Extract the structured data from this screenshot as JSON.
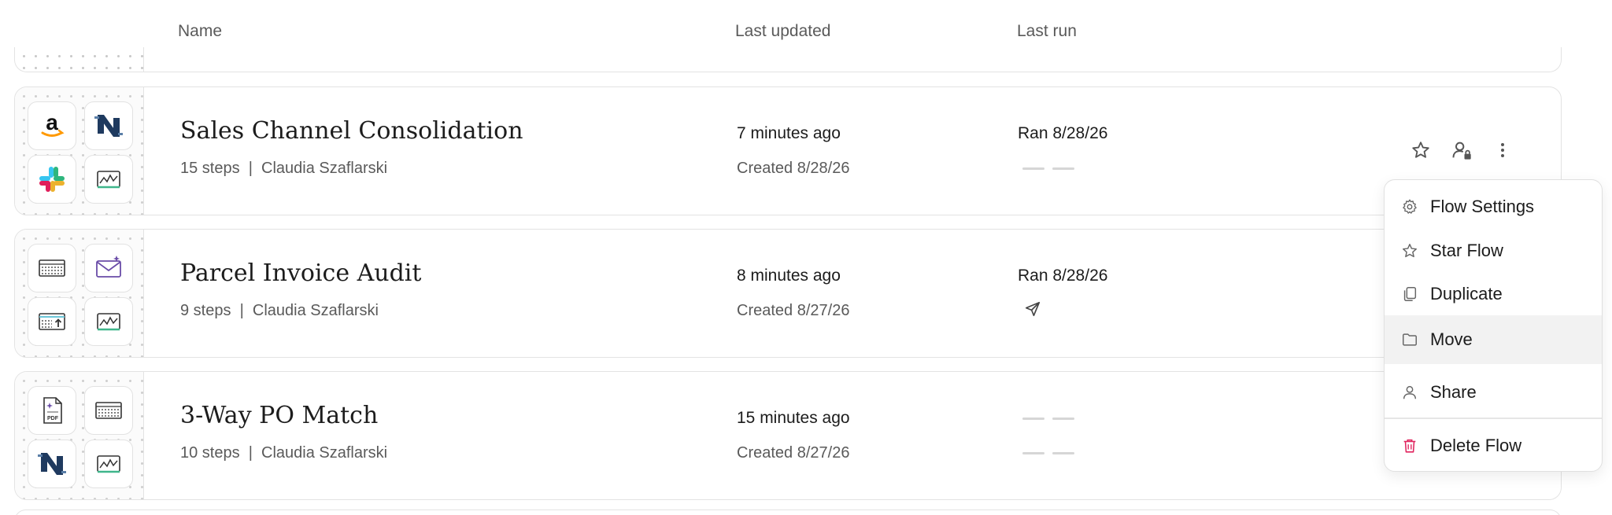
{
  "header": {
    "name": "Name",
    "last_updated": "Last updated",
    "last_run": "Last run"
  },
  "flows": [
    {
      "title": "Sales Channel Consolidation",
      "meta": "15 steps  |  Claudia Szaflarski",
      "updated": "7 minutes ago",
      "created": "Created 8/28/26",
      "last_run": "Ran 8/28/26",
      "icons": [
        "amazon-icon",
        "netsuite-icon",
        "slack-icon",
        "chart-icon"
      ]
    },
    {
      "title": "Parcel Invoice Audit",
      "meta": "9 steps  |  Claudia Szaflarski",
      "updated": "8 minutes ago",
      "created": "Created 8/27/26",
      "last_run": "Ran 8/28/26",
      "icons": [
        "table-icon",
        "email-icon",
        "upload-table-icon",
        "chart-icon"
      ]
    },
    {
      "title": "3-Way PO Match",
      "meta": "10 steps  |  Claudia Szaflarski",
      "updated": "15 minutes ago",
      "created": "Created 8/27/26",
      "last_run": "",
      "icons": [
        "pdf-icon",
        "table-icon",
        "netsuite-icon",
        "chart-icon"
      ]
    }
  ],
  "menu": {
    "items": [
      {
        "label": "Flow Settings",
        "icon": "gear-icon"
      },
      {
        "label": "Star Flow",
        "icon": "star-icon"
      },
      {
        "label": "Duplicate",
        "icon": "duplicate-icon"
      },
      {
        "label": "Move",
        "icon": "folder-icon"
      },
      {
        "label": "Share",
        "icon": "user-icon"
      },
      {
        "label": "Delete Flow",
        "icon": "trash-icon"
      }
    ]
  },
  "colors": {
    "delete_icon": "#e0245e",
    "netsuite_navy": "#1f3a5f",
    "amazon_orange": "#ff9900"
  }
}
